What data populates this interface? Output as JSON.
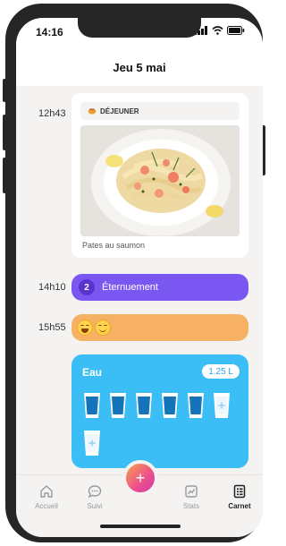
{
  "status_bar": {
    "time": "14:16"
  },
  "header": {
    "date_title": "Jeu 5 mai"
  },
  "timeline": {
    "meal": {
      "time": "12h43",
      "category": "DÉJEUNER",
      "dish": "Pates au saumon"
    },
    "sneeze": {
      "time": "14h10",
      "count": "2",
      "label": "Éternuement"
    },
    "mood": {
      "time": "15h55",
      "emojis": [
        "grinning-face",
        "smiling-face"
      ]
    },
    "water": {
      "title": "Eau",
      "amount": "1.25 L",
      "glasses_filled": 5,
      "glasses_total": 7
    }
  },
  "bottom_nav": {
    "items": [
      {
        "label": "Accueil",
        "icon": "home-icon"
      },
      {
        "label": "Suivi",
        "icon": "chat-icon"
      },
      {
        "label": "Stats",
        "icon": "stats-icon"
      },
      {
        "label": "Carnet",
        "icon": "notebook-icon",
        "active": true
      }
    ],
    "fab_symbol": "+"
  },
  "colors": {
    "sneeze": "#7b57f2",
    "mood": "#f7b165",
    "water": "#3bbdf5",
    "fab_gradient": [
      "#f3a34a",
      "#ee4e8d"
    ]
  }
}
